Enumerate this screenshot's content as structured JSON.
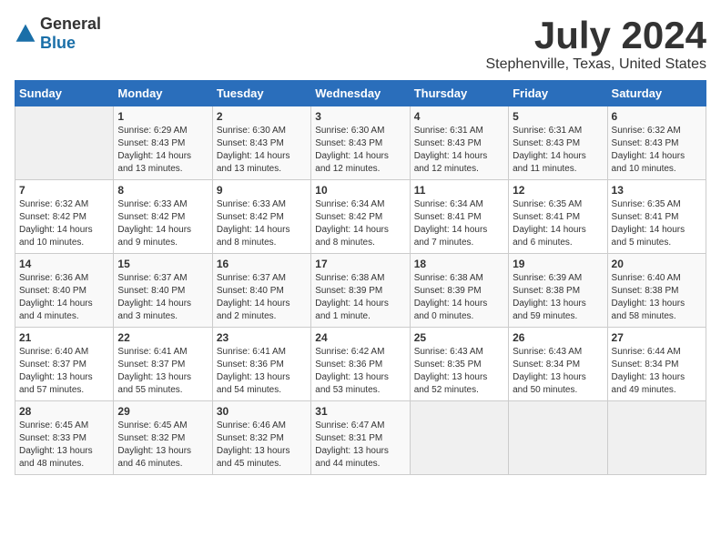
{
  "logo": {
    "general": "General",
    "blue": "Blue"
  },
  "title": "July 2024",
  "subtitle": "Stephenville, Texas, United States",
  "days_header": [
    "Sunday",
    "Monday",
    "Tuesday",
    "Wednesday",
    "Thursday",
    "Friday",
    "Saturday"
  ],
  "weeks": [
    [
      {
        "day": "",
        "info": ""
      },
      {
        "day": "1",
        "info": "Sunrise: 6:29 AM\nSunset: 8:43 PM\nDaylight: 14 hours and 13 minutes."
      },
      {
        "day": "2",
        "info": "Sunrise: 6:30 AM\nSunset: 8:43 PM\nDaylight: 14 hours and 13 minutes."
      },
      {
        "day": "3",
        "info": "Sunrise: 6:30 AM\nSunset: 8:43 PM\nDaylight: 14 hours and 12 minutes."
      },
      {
        "day": "4",
        "info": "Sunrise: 6:31 AM\nSunset: 8:43 PM\nDaylight: 14 hours and 12 minutes."
      },
      {
        "day": "5",
        "info": "Sunrise: 6:31 AM\nSunset: 8:43 PM\nDaylight: 14 hours and 11 minutes."
      },
      {
        "day": "6",
        "info": "Sunrise: 6:32 AM\nSunset: 8:43 PM\nDaylight: 14 hours and 10 minutes."
      }
    ],
    [
      {
        "day": "7",
        "info": "Sunrise: 6:32 AM\nSunset: 8:42 PM\nDaylight: 14 hours and 10 minutes."
      },
      {
        "day": "8",
        "info": "Sunrise: 6:33 AM\nSunset: 8:42 PM\nDaylight: 14 hours and 9 minutes."
      },
      {
        "day": "9",
        "info": "Sunrise: 6:33 AM\nSunset: 8:42 PM\nDaylight: 14 hours and 8 minutes."
      },
      {
        "day": "10",
        "info": "Sunrise: 6:34 AM\nSunset: 8:42 PM\nDaylight: 14 hours and 8 minutes."
      },
      {
        "day": "11",
        "info": "Sunrise: 6:34 AM\nSunset: 8:41 PM\nDaylight: 14 hours and 7 minutes."
      },
      {
        "day": "12",
        "info": "Sunrise: 6:35 AM\nSunset: 8:41 PM\nDaylight: 14 hours and 6 minutes."
      },
      {
        "day": "13",
        "info": "Sunrise: 6:35 AM\nSunset: 8:41 PM\nDaylight: 14 hours and 5 minutes."
      }
    ],
    [
      {
        "day": "14",
        "info": "Sunrise: 6:36 AM\nSunset: 8:40 PM\nDaylight: 14 hours and 4 minutes."
      },
      {
        "day": "15",
        "info": "Sunrise: 6:37 AM\nSunset: 8:40 PM\nDaylight: 14 hours and 3 minutes."
      },
      {
        "day": "16",
        "info": "Sunrise: 6:37 AM\nSunset: 8:40 PM\nDaylight: 14 hours and 2 minutes."
      },
      {
        "day": "17",
        "info": "Sunrise: 6:38 AM\nSunset: 8:39 PM\nDaylight: 14 hours and 1 minute."
      },
      {
        "day": "18",
        "info": "Sunrise: 6:38 AM\nSunset: 8:39 PM\nDaylight: 14 hours and 0 minutes."
      },
      {
        "day": "19",
        "info": "Sunrise: 6:39 AM\nSunset: 8:38 PM\nDaylight: 13 hours and 59 minutes."
      },
      {
        "day": "20",
        "info": "Sunrise: 6:40 AM\nSunset: 8:38 PM\nDaylight: 13 hours and 58 minutes."
      }
    ],
    [
      {
        "day": "21",
        "info": "Sunrise: 6:40 AM\nSunset: 8:37 PM\nDaylight: 13 hours and 57 minutes."
      },
      {
        "day": "22",
        "info": "Sunrise: 6:41 AM\nSunset: 8:37 PM\nDaylight: 13 hours and 55 minutes."
      },
      {
        "day": "23",
        "info": "Sunrise: 6:41 AM\nSunset: 8:36 PM\nDaylight: 13 hours and 54 minutes."
      },
      {
        "day": "24",
        "info": "Sunrise: 6:42 AM\nSunset: 8:36 PM\nDaylight: 13 hours and 53 minutes."
      },
      {
        "day": "25",
        "info": "Sunrise: 6:43 AM\nSunset: 8:35 PM\nDaylight: 13 hours and 52 minutes."
      },
      {
        "day": "26",
        "info": "Sunrise: 6:43 AM\nSunset: 8:34 PM\nDaylight: 13 hours and 50 minutes."
      },
      {
        "day": "27",
        "info": "Sunrise: 6:44 AM\nSunset: 8:34 PM\nDaylight: 13 hours and 49 minutes."
      }
    ],
    [
      {
        "day": "28",
        "info": "Sunrise: 6:45 AM\nSunset: 8:33 PM\nDaylight: 13 hours and 48 minutes."
      },
      {
        "day": "29",
        "info": "Sunrise: 6:45 AM\nSunset: 8:32 PM\nDaylight: 13 hours and 46 minutes."
      },
      {
        "day": "30",
        "info": "Sunrise: 6:46 AM\nSunset: 8:32 PM\nDaylight: 13 hours and 45 minutes."
      },
      {
        "day": "31",
        "info": "Sunrise: 6:47 AM\nSunset: 8:31 PM\nDaylight: 13 hours and 44 minutes."
      },
      {
        "day": "",
        "info": ""
      },
      {
        "day": "",
        "info": ""
      },
      {
        "day": "",
        "info": ""
      }
    ]
  ]
}
